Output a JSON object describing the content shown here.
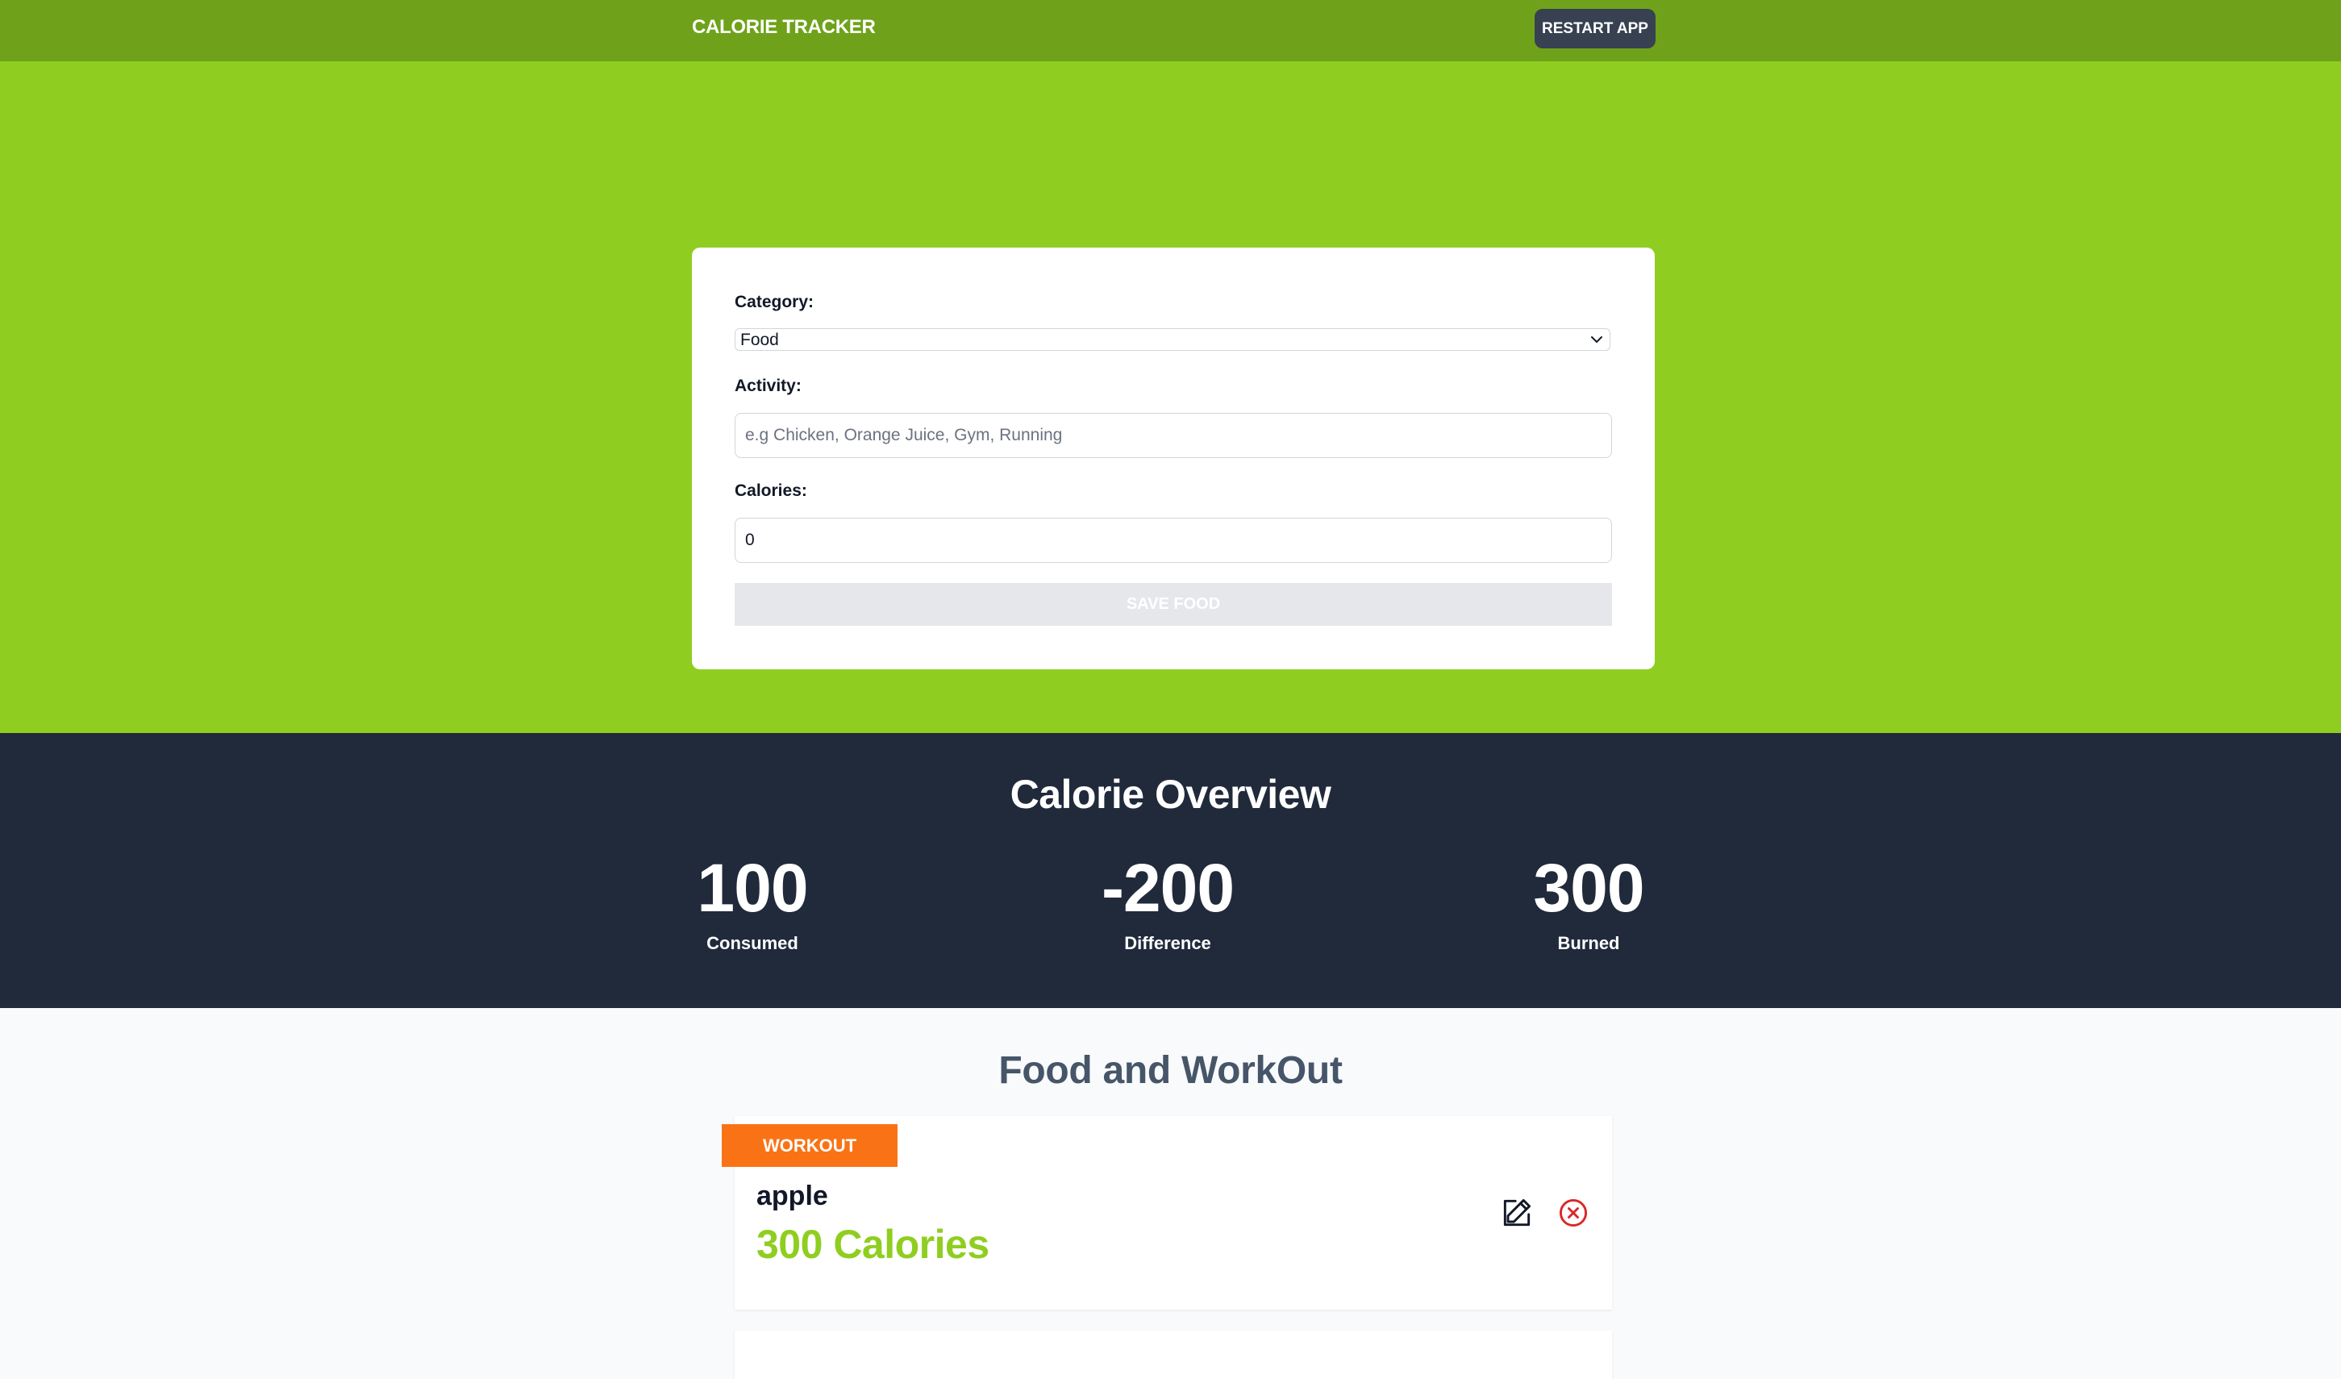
{
  "header": {
    "brand": "CALORIE TRACKER",
    "restart_label": "RESTART APP"
  },
  "form": {
    "category_label": "Category:",
    "category_value": "Food",
    "activity_label": "Activity:",
    "activity_placeholder": "e.g Chicken, Orange Juice, Gym, Running",
    "activity_value": "",
    "calories_label": "Calories:",
    "calories_value": "0",
    "save_label": "SAVE FOOD"
  },
  "overview": {
    "title": "Calorie Overview",
    "stats": [
      {
        "value": "100",
        "label": "Consumed"
      },
      {
        "value": "-200",
        "label": "Difference"
      },
      {
        "value": "300",
        "label": "Burned"
      }
    ]
  },
  "list": {
    "title": "Food and WorkOut",
    "items": [
      {
        "tag": "WORKOUT",
        "name": "apple",
        "calories": "300 Calories"
      }
    ]
  },
  "icons": {
    "edit": "edit-icon",
    "delete": "close-circle-icon",
    "select_arrow": "chevron-down-icon"
  },
  "colors": {
    "header": "#6fa21a",
    "hero": "#8fce20",
    "overview": "#202a3b",
    "workout_tag": "#f97316",
    "delete": "#dc2626"
  }
}
